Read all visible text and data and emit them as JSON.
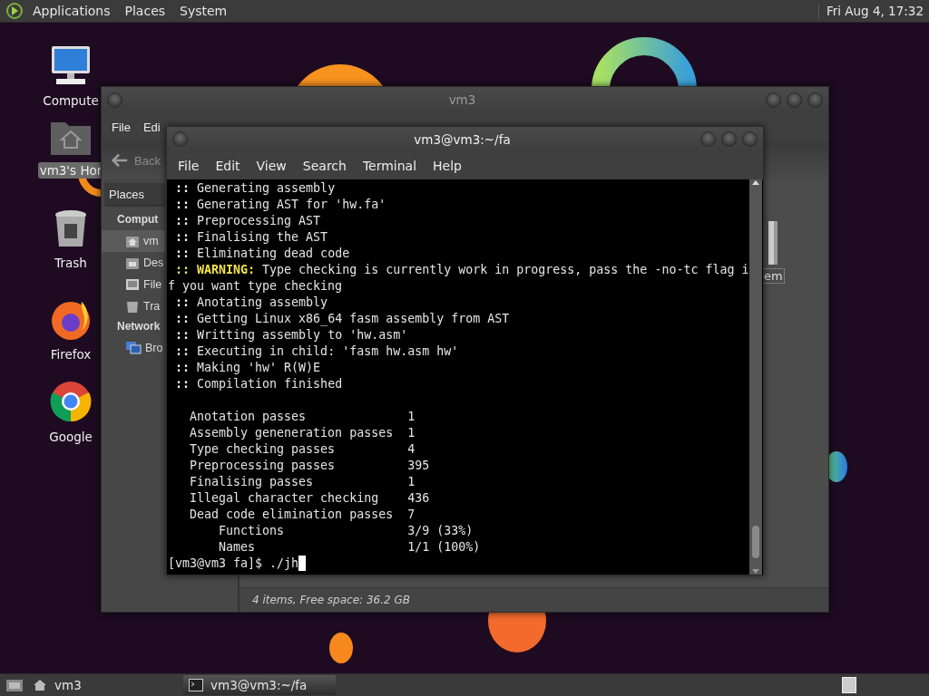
{
  "top_panel": {
    "menus": [
      "Applications",
      "Places",
      "System"
    ],
    "clock": "Fri Aug  4, 17:32"
  },
  "desktop_icons": [
    {
      "label": "Compute",
      "selected": false
    },
    {
      "label": "vm3's Hor",
      "selected": true
    },
    {
      "label": "Trash",
      "selected": false
    },
    {
      "label": "Firefox",
      "selected": false
    },
    {
      "label": "Google",
      "selected": false
    }
  ],
  "file_manager": {
    "title": "vm3",
    "menu": [
      "File",
      "Edi"
    ],
    "back_label": "Back",
    "places_label": "Places",
    "sidebar": [
      {
        "kind": "heading",
        "label": "Comput"
      },
      {
        "kind": "item",
        "label": "vm",
        "selected": true
      },
      {
        "kind": "item",
        "label": "Des",
        "selected": false
      },
      {
        "kind": "item",
        "label": "File",
        "selected": false
      },
      {
        "kind": "item",
        "label": "Tra",
        "selected": false
      },
      {
        "kind": "heading",
        "label": "Network"
      },
      {
        "kind": "item",
        "label": "Bro",
        "selected": false
      }
    ],
    "items": [
      {
        "label": "em",
        "selected": true
      }
    ],
    "status": "4 items, Free space: 36.2 GB"
  },
  "terminal": {
    "title": "vm3@vm3:~/fa",
    "menu": [
      "File",
      "Edit",
      "View",
      "Search",
      "Terminal",
      "Help"
    ],
    "lines": [
      {
        "kind": "step",
        "marker": "::",
        "text": "Generating assembly"
      },
      {
        "kind": "step",
        "marker": "::",
        "text": "Generating AST for 'hw.fa'"
      },
      {
        "kind": "step",
        "marker": "::",
        "text": "Preprocessing AST"
      },
      {
        "kind": "step",
        "marker": "::",
        "text": "Finalising the AST"
      },
      {
        "kind": "step",
        "marker": "::",
        "text": "Eliminating dead code"
      },
      {
        "kind": "warning",
        "marker": "::",
        "label": "WARNING:",
        "text": "Type checking is currently work in progress, pass the -no-tc flag i"
      },
      {
        "kind": "plain",
        "text": "f you want type checking"
      },
      {
        "kind": "step",
        "marker": "::",
        "text": "Anotating assembly"
      },
      {
        "kind": "step",
        "marker": "::",
        "text": "Getting Linux x86_64 fasm assembly from AST"
      },
      {
        "kind": "step",
        "marker": "::",
        "text": "Writting assembly to 'hw.asm'"
      },
      {
        "kind": "step",
        "marker": "::",
        "text": "Executing in child: 'fasm hw.asm hw'"
      },
      {
        "kind": "step",
        "marker": "::",
        "text": "Making 'hw' R(W)E"
      },
      {
        "kind": "step",
        "marker": "::",
        "text": "Compilation finished"
      },
      {
        "kind": "blank"
      },
      {
        "kind": "stat",
        "label": "Anotation passes",
        "value": "1"
      },
      {
        "kind": "stat",
        "label": "Assembly geneneration passes",
        "value": "1"
      },
      {
        "kind": "stat",
        "label": "Type checking passes",
        "value": "4"
      },
      {
        "kind": "stat",
        "label": "Preprocessing passes",
        "value": "395"
      },
      {
        "kind": "stat",
        "label": "Finalising passes",
        "value": "1"
      },
      {
        "kind": "stat",
        "label": "Illegal character checking",
        "value": "436"
      },
      {
        "kind": "stat",
        "label": "Dead code elimination passes",
        "value": "7"
      },
      {
        "kind": "substat",
        "label": "Functions",
        "value": "3/9 (33%)"
      },
      {
        "kind": "substat",
        "label": "Names",
        "value": "1/1 (100%)"
      }
    ],
    "prompt": "[vm3@vm3 fa]$",
    "input": "./jh"
  },
  "taskbar": {
    "tasks": [
      {
        "label": "vm3",
        "selected": false
      },
      {
        "label": "vm3@vm3:~/fa",
        "selected": true
      }
    ]
  }
}
